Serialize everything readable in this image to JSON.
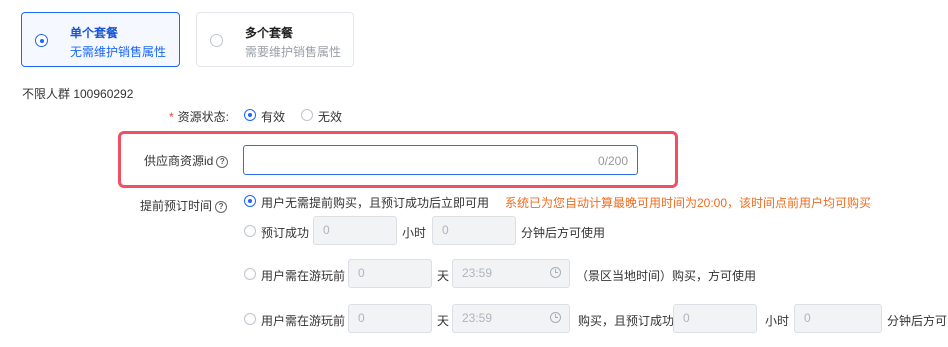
{
  "package_options": [
    {
      "title": "单个套餐",
      "subtitle": "无需维护销售属性",
      "selected": true
    },
    {
      "title": "多个套餐",
      "subtitle": "需要维护销售属性",
      "selected": false
    }
  ],
  "audience_line": "不限人群 100960292",
  "resource_status": {
    "label": "资源状态:",
    "options": [
      "有效",
      "无效"
    ],
    "selected": "有效"
  },
  "supplier_id": {
    "label": "供应商资源id",
    "value": "",
    "counter": "0/200"
  },
  "advance_booking": {
    "label": "提前预订时间",
    "option1": "用户无需提前购买，且预订成功后立即可用",
    "notice": "系统已为您自动计算最晚可用时间为20:00，该时间点前用户均可购买",
    "option2": {
      "prefix": "预订成功",
      "hours_value": "0",
      "hours_unit": "小时",
      "minutes_value": "0",
      "suffix": "分钟后方可使用"
    },
    "option3": {
      "prefix": "用户需在游玩前",
      "days_value": "0",
      "days_unit": "天",
      "time_value": "23:59",
      "suffix": "（景区当地时间）购买，方可使用"
    },
    "option4": {
      "prefix": "用户需在游玩前",
      "days_value": "0",
      "days_unit": "天",
      "time_value": "23:59",
      "middle": "购买，且预订成功",
      "hours_value": "0",
      "hours_unit": "小时",
      "minutes_value": "0",
      "suffix": "分钟后方可"
    }
  },
  "colors": {
    "primary": "#1a66ff",
    "highlight": "#f04f64",
    "notice": "#ef6c1e",
    "required": "#f0443c"
  }
}
